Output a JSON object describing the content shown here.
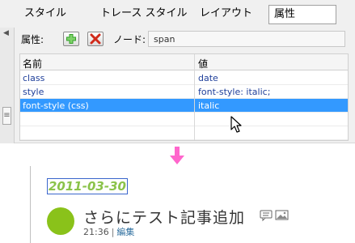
{
  "tabs": {
    "style": "スタイル",
    "trace_style": "トレース スタイル",
    "layout": "レイアウト",
    "attributes": "属性"
  },
  "toolbar": {
    "attr_label": "属性:",
    "add_icon": "plus-icon",
    "remove_icon": "x-icon",
    "node_label": "ノード:",
    "node_value": "span"
  },
  "grid": {
    "columns": [
      "名前",
      "値"
    ],
    "rows": [
      {
        "name": "class",
        "value": "date"
      },
      {
        "name": "style",
        "value": "font-style: italic;"
      },
      {
        "name": "font-style (css)",
        "value": "italic",
        "selected": true
      },
      {
        "name": "",
        "value": ""
      },
      {
        "name": "",
        "value": ""
      }
    ]
  },
  "preview": {
    "date": "2011-03-30",
    "title": "さらにテスト記事追加",
    "time": "21:36",
    "separator": "|",
    "edit": "編集",
    "icons": [
      "comment-icon",
      "image-icon"
    ]
  },
  "colors": {
    "selection": "#3399ff",
    "arrow": "#ff66cc",
    "date_text": "#8bc34a",
    "dot": "#8ac21a",
    "link": "#2f6f9f"
  }
}
